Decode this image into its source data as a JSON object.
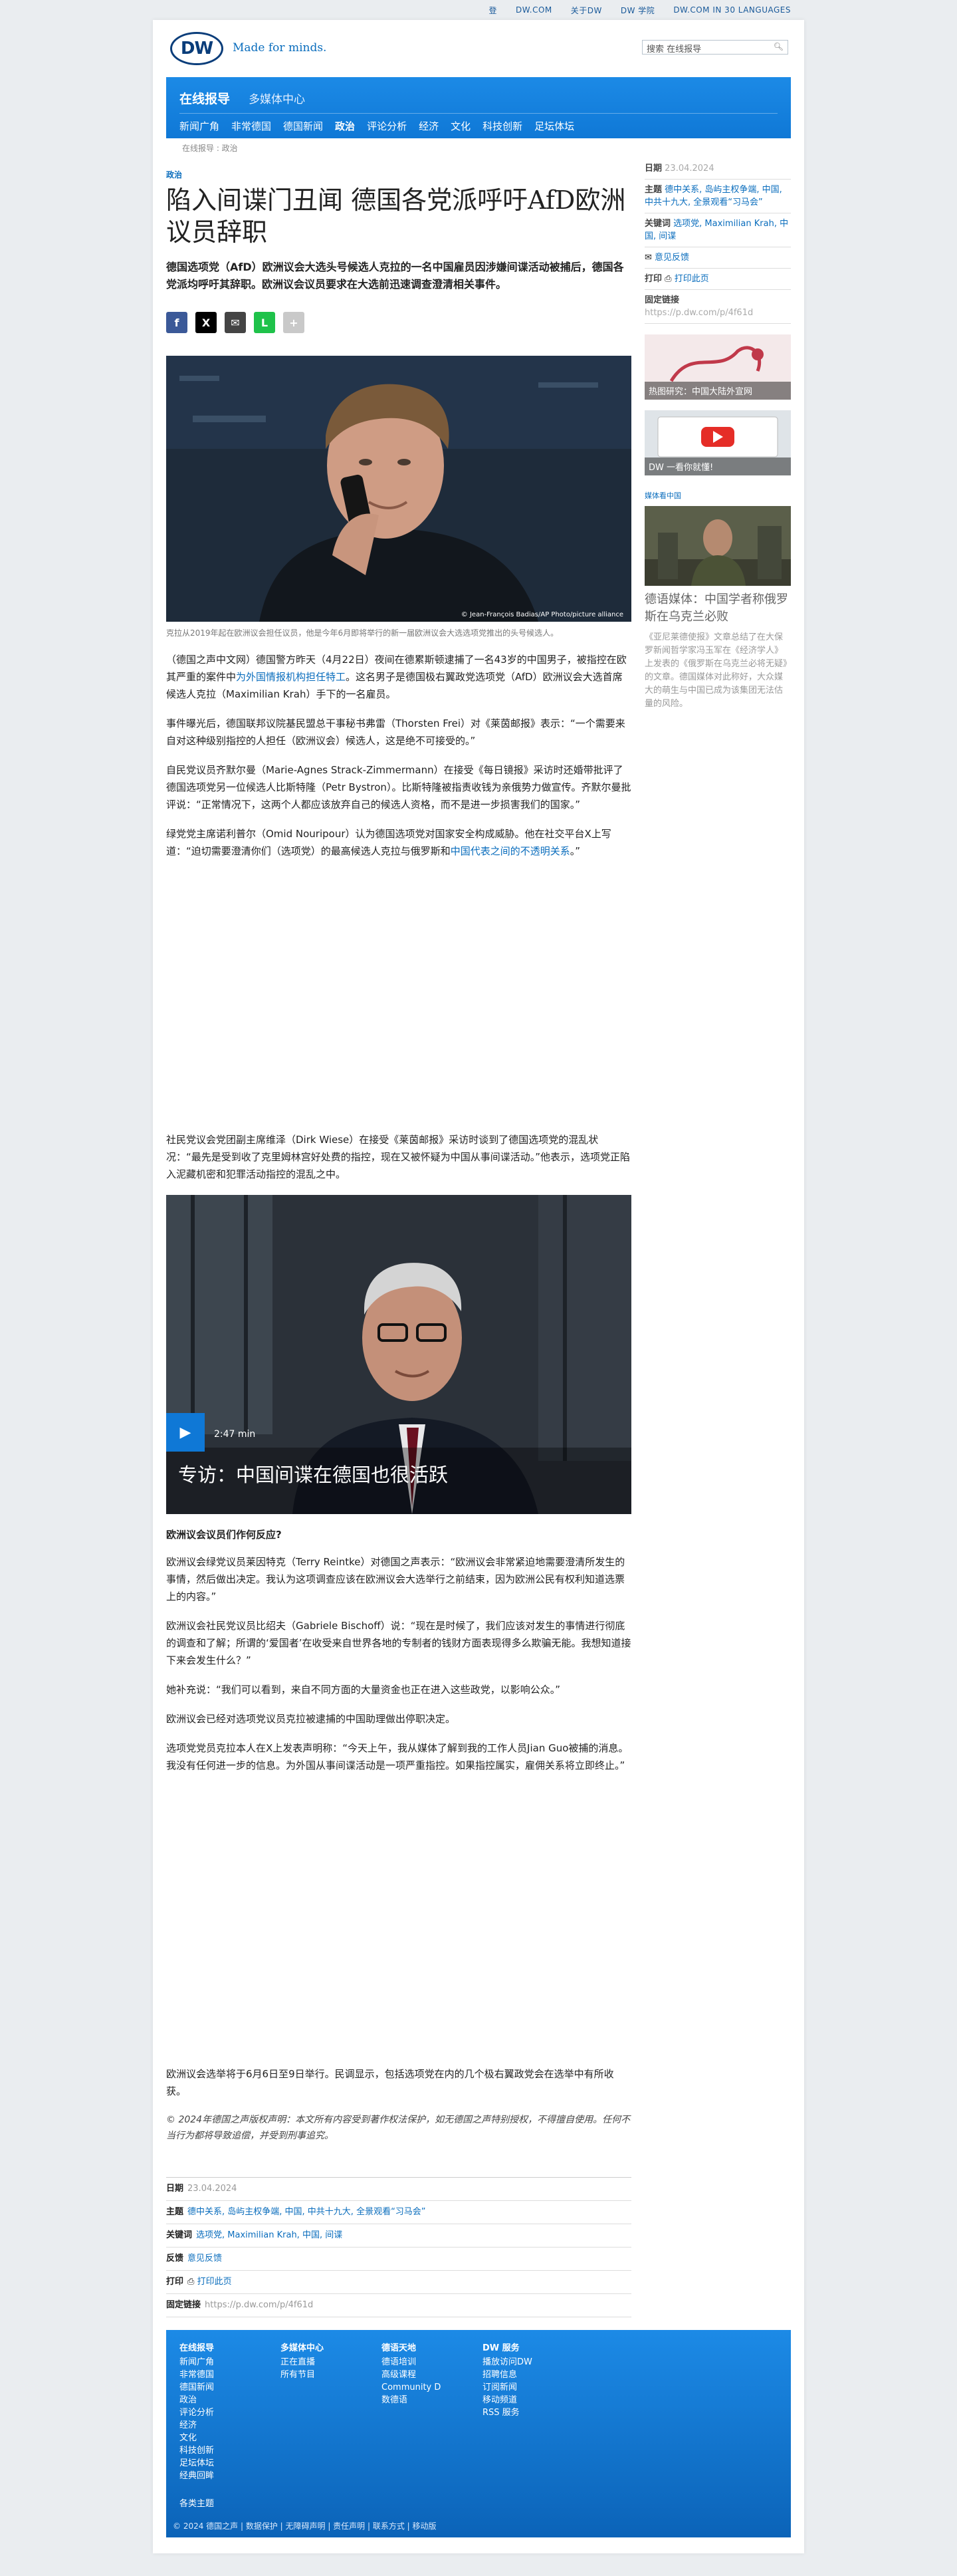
{
  "topbar": [
    "登",
    "DW.COM",
    "关于DW",
    "DW 学院",
    "DW.COM IN 30 LANGUAGES"
  ],
  "brand": {
    "logo": "DW",
    "tagline": "Made for minds."
  },
  "search": {
    "placeholder": "搜索 在线报导"
  },
  "nav": {
    "title": "在线报导",
    "subtitle": "多媒体中心",
    "links": [
      "新闻广角",
      "非常德国",
      "德国新闻",
      "政治",
      "评论分析",
      "经济",
      "文化",
      "科技创新",
      "足坛体坛"
    ]
  },
  "breadcrumb": "在线报导 : 政治",
  "article": {
    "kicker": "政治",
    "title": "陷入间谍门丑闻 德国各党派呼吁AfD欧洲议员辞职",
    "lead": "德国选项党（AfD）欧洲议会大选头号候选人克拉的一名中国雇员因涉嫌间谍活动被捕后，德国各党派均呼吁其辞职。欧洲议会议员要求在大选前迅速调查澄清相关事件。",
    "hero_credit": "© Jean-François Badias/AP Photo/picture alliance",
    "caption": "克拉从2019年起在欧洲议会担任议员，他是今年6月即将举行的新一届欧洲议会大选选项党推出的头号候选人。",
    "p1a": "（德国之声中文网）德国警方昨天（4月22日）夜间在德累斯顿逮捕了一名43岁的中国男子，被指控在欧其严重的案件中",
    "p1_link": "为外国情报机构担任特工",
    "p1b": "。这名男子是德国极右翼政党选项党（AfD）欧洲议会大选首席候选人克拉（Maximilian Krah）手下的一名雇员。",
    "p2": "事件曝光后，德国联邦议院基民盟总干事秘书弗雷（Thorsten Frei）对《莱茵邮报》表示：“一个需要来自对这种级别指控的人担任（欧洲议会）候选人，这是绝不可接受的。”",
    "p3": "自民党议员齐默尔曼（Marie-Agnes Strack-Zimmermann）在接受《每日镜报》采访时还婚带批评了德国选项党另一位候选人比斯特隆（Petr Bystron）。比斯特隆被指责收钱为亲俄势力做宣传。齐默尔曼批评说：“正常情况下，这两个人都应该放弃自己的候选人资格，而不是进一步损害我们的国家。”",
    "p4a": "绿党党主席诺利普尔（Omid Nouripour）认为德国选项党对国家安全构成威胁。他在社交平台X上写道：“迫切需要澄清你们（选项党）的最高候选人克拉与俄罗斯和",
    "p4_link": "中国代表之间的不透明关系",
    "p4b": "。”",
    "p5": "社民党议会党团副主席维泽（Dirk Wiese）在接受《莱茵邮报》采访时谈到了德国选项党的混乱状况：“最先是受到收了克里姆林宫好处费的指控，现在又被怀疑为中国从事间谍活动。”他表示，选项党正陷入泥藏机密和犯罪活动指控的混乱之中。",
    "video_duration": "2:47 min",
    "video_title": "专访：中国间谍在德国也很活跃",
    "subhead": "欧洲议会议员们作何反应?",
    "p6": "欧洲议会绿党议员莱因特克（Terry Reintke）对德国之声表示：“欧洲议会非常紧迫地需要澄清所发生的事情，然后做出决定。我认为这项调查应该在欧洲议会大选举行之前结束，因为欧洲公民有权利知道选票上的内容。”",
    "p7": "欧洲议会社民党议员比绍夫（Gabriele Bischoff）说：“现在是时候了，我们应该对发生的事情进行彻底的调查和了解；所谓的‘爱国者’在收受来自世界各地的专制者的钱财方面表现得多么欺骗无能。我想知道接下来会发生什么？”",
    "p8": "她补充说：“我们可以看到，来自不同方面的大量资金也正在进入这些政党，以影响公众。”",
    "p9": "欧洲议会已经对选项党议员克拉被逮捕的中国助理做出停职决定。",
    "p10": "选项党党员克拉本人在X上发表声明称：“今天上午，我从媒体了解到我的工作人员Jian Guo被捕的消息。我没有任何进一步的信息。为外国从事间谍活动是一项严重指控。如果指控属实，雇佣关系将立即终止。”",
    "p11": "欧洲议会选举将于6月6日至9日举行。民调显示，包括选项党在内的几个极右翼政党会在选举中有所收获。",
    "copyright": "© 2024年德国之声版权声明：本文所有内容受到著作权法保护，如无德国之声特别授权，不得擅自使用。任何不当行为都将导致追偿，并受到刑事追究。"
  },
  "meta": {
    "date_label": "日期",
    "date": "23.04.2024",
    "topics_label": "主题",
    "topics": "德中关系, 岛屿主权争端, 中国, 中共十九大, 全景观看“习马会”",
    "keywords_label": "关键词",
    "keywords": "选项党, Maximilian Krah, 中国, 间谍",
    "feedback_label": "反馈",
    "feedback": "意见反馈",
    "print_label": "打印",
    "print": "打印此页",
    "permalink_label": "固定链接",
    "permalink": "https://p.dw.com/p/4f61d"
  },
  "aside": {
    "feedback_side": "意见反馈",
    "promo1": "热图研究：中国大陆外宣网",
    "promo2": "DW 一看你就懂!",
    "kicker": "媒体看中国",
    "headline": "德语媒体：中国学者称俄罗斯在乌克兰必败",
    "teaser": "《亚尼莱德使报》文章总结了在大保罗新闻哲学家冯玉军在《经济学人》上发表的《俄罗斯在乌克兰必将无疑》的文章。德国媒体对此称好，大众媒大的萌生与中国已成为该集团无法估量的风险。"
  },
  "footer": {
    "col1": {
      "head": "在线报导",
      "items": [
        "新闻广角",
        "非常德国",
        "德国新闻",
        "政治",
        "评论分析",
        "经济",
        "文化",
        "科技创新",
        "足坛体坛",
        "经典回眸"
      ]
    },
    "col2": {
      "head": "多媒体中心",
      "items": [
        "正在直播",
        "所有节目"
      ]
    },
    "col3": {
      "head": "德语天地",
      "items": [
        "德语培训",
        "高级课程",
        "Community D",
        "数德语"
      ]
    },
    "col4": {
      "head": "DW 服务",
      "items": [
        "播放访问DW",
        "招聘信息",
        "订阅新闻",
        "移动频道",
        "RSS 服务"
      ]
    },
    "all_topics": "各类主题",
    "bottom": "© 2024 德国之声 | 数据保护 | 无障碍声明 | 责任声明 | 联系方式 | 移动版"
  }
}
